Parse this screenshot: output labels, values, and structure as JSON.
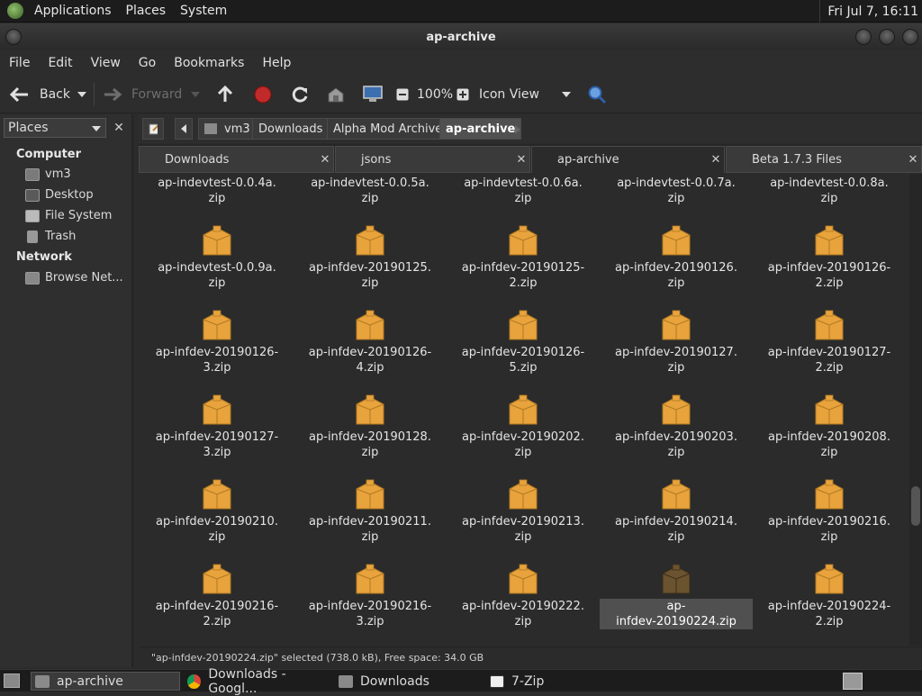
{
  "topbar": {
    "menu": [
      "Applications",
      "Places",
      "System"
    ],
    "clock": "Fri Jul  7, 16:11"
  },
  "window": {
    "title": "ap-archive"
  },
  "menubar": [
    "File",
    "Edit",
    "View",
    "Go",
    "Bookmarks",
    "Help"
  ],
  "toolbar": {
    "back": "Back",
    "forward": "Forward",
    "zoom": "100%",
    "view_mode": "Icon View"
  },
  "sidebar": {
    "title": "Places",
    "sections": [
      {
        "heading": "Computer",
        "items": [
          "vm3",
          "Desktop",
          "File System",
          "Trash"
        ]
      },
      {
        "heading": "Network",
        "items": [
          "Browse Net..."
        ]
      }
    ]
  },
  "pathbar": {
    "crumbs": [
      "vm3",
      "Downloads",
      "Alpha Mod Archive",
      "ap-archive"
    ]
  },
  "tabs": [
    "Downloads",
    "jsons",
    "ap-archive",
    "Beta 1.7.3 Files"
  ],
  "files": [
    [
      "ap-indevtest-0.0.4a.",
      "zip"
    ],
    [
      "ap-indevtest-0.0.5a.",
      "zip"
    ],
    [
      "ap-indevtest-0.0.6a.",
      "zip"
    ],
    [
      "ap-indevtest-0.0.7a.",
      "zip"
    ],
    [
      "ap-indevtest-0.0.8a.",
      "zip"
    ],
    [
      "ap-indevtest-0.0.9a.",
      "zip"
    ],
    [
      "ap-infdev-20190125.",
      "zip"
    ],
    [
      "ap-infdev-20190125-",
      "2.zip"
    ],
    [
      "ap-infdev-20190126.",
      "zip"
    ],
    [
      "ap-infdev-20190126-",
      "2.zip"
    ],
    [
      "ap-infdev-20190126-",
      "3.zip"
    ],
    [
      "ap-infdev-20190126-",
      "4.zip"
    ],
    [
      "ap-infdev-20190126-",
      "5.zip"
    ],
    [
      "ap-infdev-20190127.",
      "zip"
    ],
    [
      "ap-infdev-20190127-",
      "2.zip"
    ],
    [
      "ap-infdev-20190127-",
      "3.zip"
    ],
    [
      "ap-infdev-20190128.",
      "zip"
    ],
    [
      "ap-infdev-20190202.",
      "zip"
    ],
    [
      "ap-infdev-20190203.",
      "zip"
    ],
    [
      "ap-infdev-20190208.",
      "zip"
    ],
    [
      "ap-infdev-20190210.",
      "zip"
    ],
    [
      "ap-infdev-20190211.",
      "zip"
    ],
    [
      "ap-infdev-20190213.",
      "zip"
    ],
    [
      "ap-infdev-20190214.",
      "zip"
    ],
    [
      "ap-infdev-20190216.",
      "zip"
    ],
    [
      "ap-infdev-20190216-",
      "2.zip"
    ],
    [
      "ap-infdev-20190216-",
      "3.zip"
    ],
    [
      "ap-infdev-20190222.",
      "zip"
    ],
    [
      "ap-",
      "infdev-20190224.zip"
    ],
    [
      "ap-infdev-20190224-",
      "2.zip"
    ]
  ],
  "selected_index": 28,
  "status": "\"ap-infdev-20190224.zip\" selected (738.0 kB), Free space: 34.0 GB",
  "taskbar": [
    "ap-archive",
    "Downloads - Googl...",
    "Downloads",
    "7-Zip"
  ],
  "colors": {
    "box": "#e8a33c",
    "box_selected": "#6b5330",
    "accent": "#505050"
  }
}
